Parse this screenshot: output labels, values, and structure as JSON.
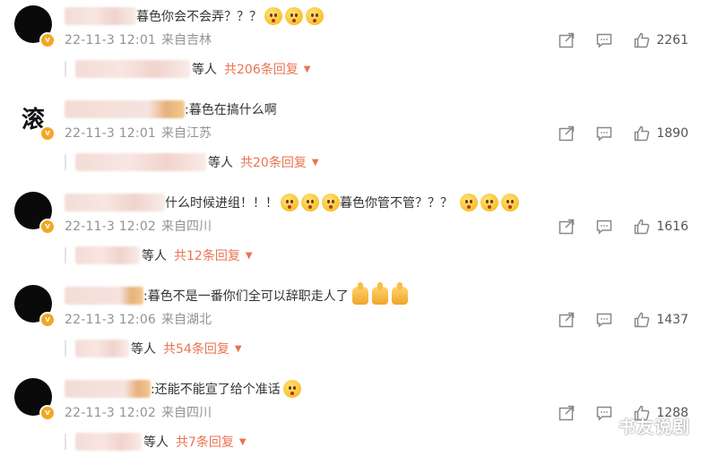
{
  "comments": [
    {
      "text": "暮色你会不会弄？？？",
      "emoji_count": 3,
      "date": "22-11-3 12:01",
      "location": "来自吉林",
      "likes": "2261",
      "reply_people": "等人",
      "reply_total": "共206条回复"
    },
    {
      "avatar_glyph": "滚",
      "text": ":暮色在搞什么啊",
      "date": "22-11-3 12:01",
      "location": "来自江苏",
      "likes": "1890",
      "reply_people": "等人",
      "reply_total": "共20条回复"
    },
    {
      "text_a": "什么时候进组！！！",
      "text_b": "暮色你管不管？？？",
      "date": "22-11-3 12:02",
      "location": "来自四川",
      "likes": "1616",
      "reply_people": "等人",
      "reply_total": "共12条回复"
    },
    {
      "text": ":暮色不是一番你们全可以辞职走人了",
      "date": "22-11-3 12:06",
      "location": "来自湖北",
      "likes": "1437",
      "reply_people": "等人",
      "reply_total": "共54条回复"
    },
    {
      "text": ":还能不能宣了给个准话",
      "date": "22-11-3 12:02",
      "location": "来自四川",
      "likes": "1288",
      "reply_people": "等人",
      "reply_total": "共7条回复"
    }
  ],
  "watermark": "书友说剧",
  "icons": {
    "share": "share-icon",
    "comment": "comment-icon",
    "like": "thumbs-up-icon",
    "verified": "verified-badge-icon",
    "caret": "caret-down-icon"
  },
  "colors": {
    "accent": "#eb7350",
    "meta_gray": "#939393",
    "verified": "#f4a623"
  }
}
